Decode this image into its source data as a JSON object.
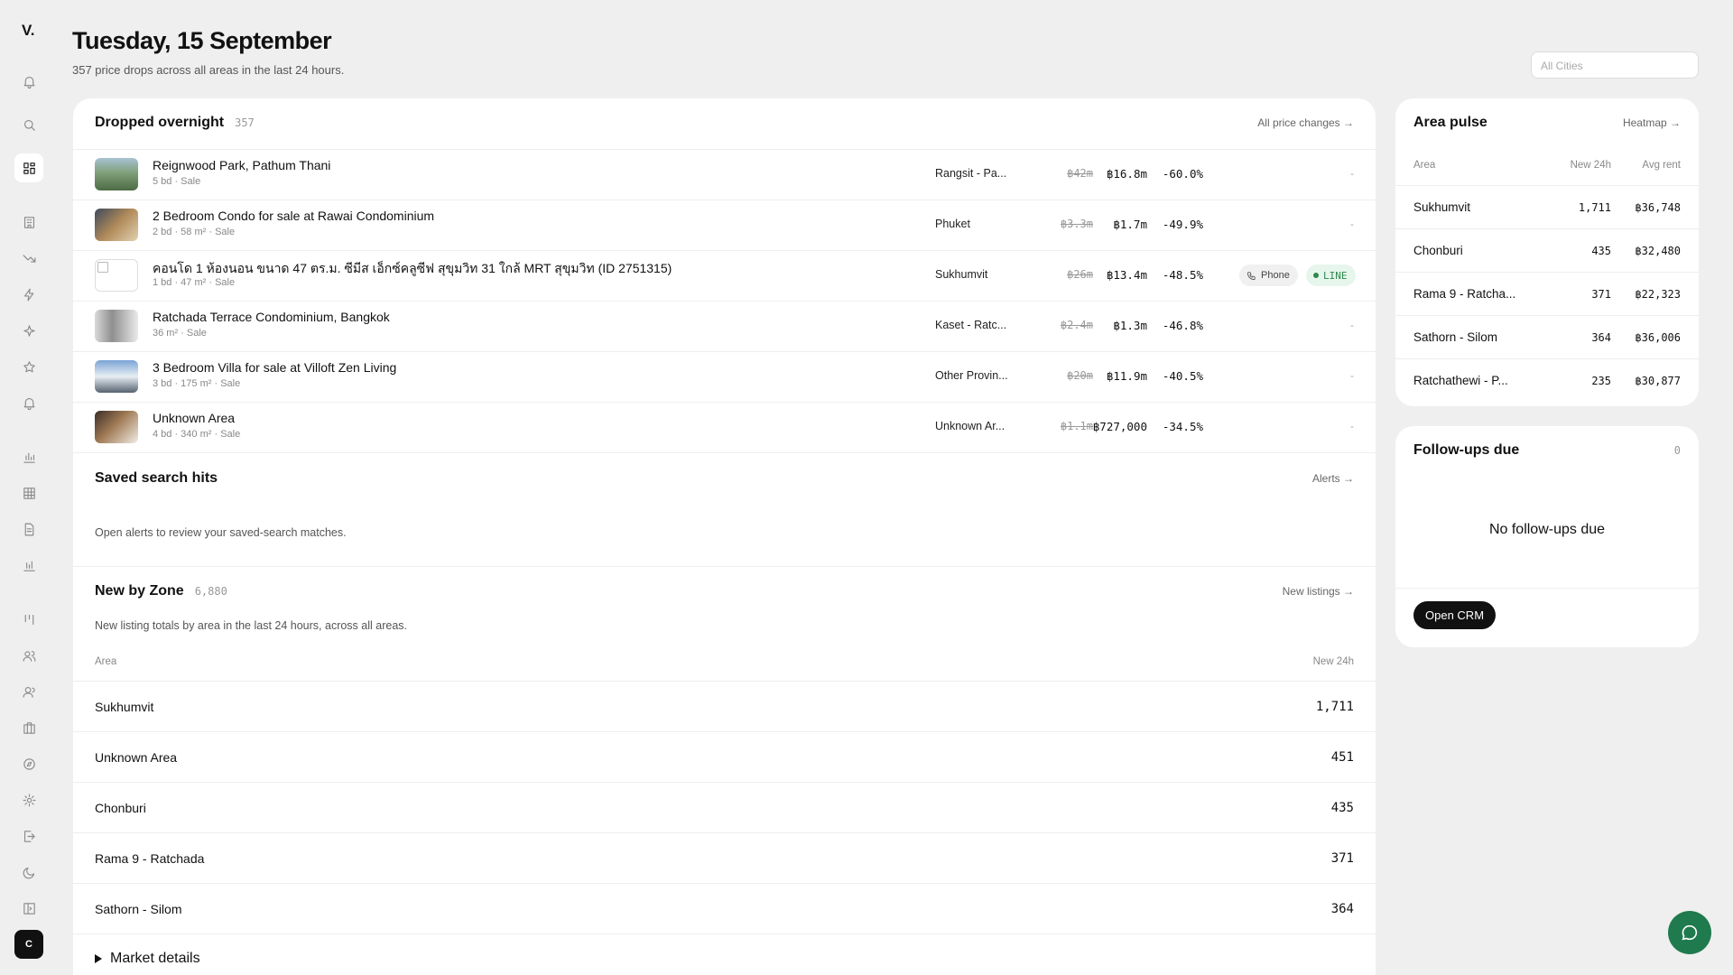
{
  "brand": {
    "logo": "V."
  },
  "header": {
    "title": "Tuesday, 15 September",
    "subtitle": "357 price drops across all areas in the last 24 hours.",
    "city_placeholder": "All Cities"
  },
  "sidebar": {
    "icons": [
      "bell-icon",
      "search-icon",
      "dashboard-icon",
      "building-icon",
      "trending-down-icon",
      "zap-icon",
      "sparkles-icon",
      "star-icon",
      "bell-ring-icon",
      "bar-chart-icon",
      "grid-icon",
      "document-icon",
      "chart-icon",
      "kanban-icon",
      "users-icon",
      "contacts-icon",
      "briefcase-icon",
      "compass-icon",
      "settings-icon",
      "logout-icon",
      "moon-icon",
      "sidebar-toggle-icon"
    ],
    "avatar": "C"
  },
  "dropped": {
    "title": "Dropped overnight",
    "count": "357",
    "link": "All price changes →",
    "rows": [
      {
        "title": "Reignwood Park, Pathum Thani",
        "meta": "5 bd · Sale",
        "area": "Rangsit - Pa...",
        "old": "฿42m",
        "new": "฿16.8m",
        "pct": "-60.0%",
        "contact": "-"
      },
      {
        "title": "2 Bedroom Condo for sale at Rawai Condominium",
        "meta": "2 bd · 58 m² · Sale",
        "area": "Phuket",
        "old": "฿3.3m",
        "new": "฿1.7m",
        "pct": "-49.9%",
        "contact": "-"
      },
      {
        "title": "คอนโด 1 ห้องนอน ขนาด 47 ตร.ม. ซีมีส เอ็กซ์คลูซีฟ สุขุมวิท 31 ใกล้ MRT สุขุมวิท (ID 2751315)",
        "meta": "1 bd · 47 m² · Sale",
        "area": "Sukhumvit",
        "old": "฿26m",
        "new": "฿13.4m",
        "pct": "-48.5%",
        "phone": "Phone",
        "line": "LINE"
      },
      {
        "title": "Ratchada Terrace Condominium, Bangkok",
        "meta": "36 m² · Sale",
        "area": "Kaset - Ratc...",
        "old": "฿2.4m",
        "new": "฿1.3m",
        "pct": "-46.8%",
        "contact": "-"
      },
      {
        "title": "3 Bedroom Villa for sale at Villoft Zen Living",
        "meta": "3 bd · 175 m² · Sale",
        "area": "Other Provin...",
        "old": "฿20m",
        "new": "฿11.9m",
        "pct": "-40.5%",
        "contact": "-"
      },
      {
        "title": "Unknown Area",
        "meta": "4 bd · 340 m² · Sale",
        "area": "Unknown Ar...",
        "old": "฿1.1m",
        "new": "฿727,000",
        "pct": "-34.5%",
        "contact": "-"
      }
    ]
  },
  "saved": {
    "title": "Saved search hits",
    "link": "Alerts →",
    "text": "Open alerts to review your saved-search matches."
  },
  "zone": {
    "title": "New by Zone",
    "count": "6,880",
    "link": "New listings →",
    "text": "New listing totals by area in the last 24 hours, across all areas.",
    "col_area": "Area",
    "col_new": "New 24h",
    "rows": [
      {
        "area": "Sukhumvit",
        "value": "1,711"
      },
      {
        "area": "Unknown Area",
        "value": "451"
      },
      {
        "area": "Chonburi",
        "value": "435"
      },
      {
        "area": "Rama 9 - Ratchada",
        "value": "371"
      },
      {
        "area": "Sathorn - Silom",
        "value": "364"
      }
    ],
    "market_details": "Market details"
  },
  "pulse": {
    "title": "Area pulse",
    "link": "Heatmap →",
    "col_area": "Area",
    "col_new": "New 24h",
    "col_rent": "Avg rent",
    "rows": [
      {
        "area": "Sukhumvit",
        "new": "1,711",
        "rent": "฿36,748"
      },
      {
        "area": "Chonburi",
        "new": "435",
        "rent": "฿32,480"
      },
      {
        "area": "Rama 9 - Ratcha...",
        "new": "371",
        "rent": "฿22,323"
      },
      {
        "area": "Sathorn - Silom",
        "new": "364",
        "rent": "฿36,006"
      },
      {
        "area": "Ratchathewi - P...",
        "new": "235",
        "rent": "฿30,877"
      }
    ]
  },
  "followups": {
    "title": "Follow-ups due",
    "count": "0",
    "empty": "No follow-ups due",
    "button": "Open CRM"
  },
  "colors": {
    "accent": "#1f7a4d",
    "line_badge_bg": "#e7f6ec",
    "line_badge_text": "#2b8a4c",
    "background": "#efefef"
  }
}
